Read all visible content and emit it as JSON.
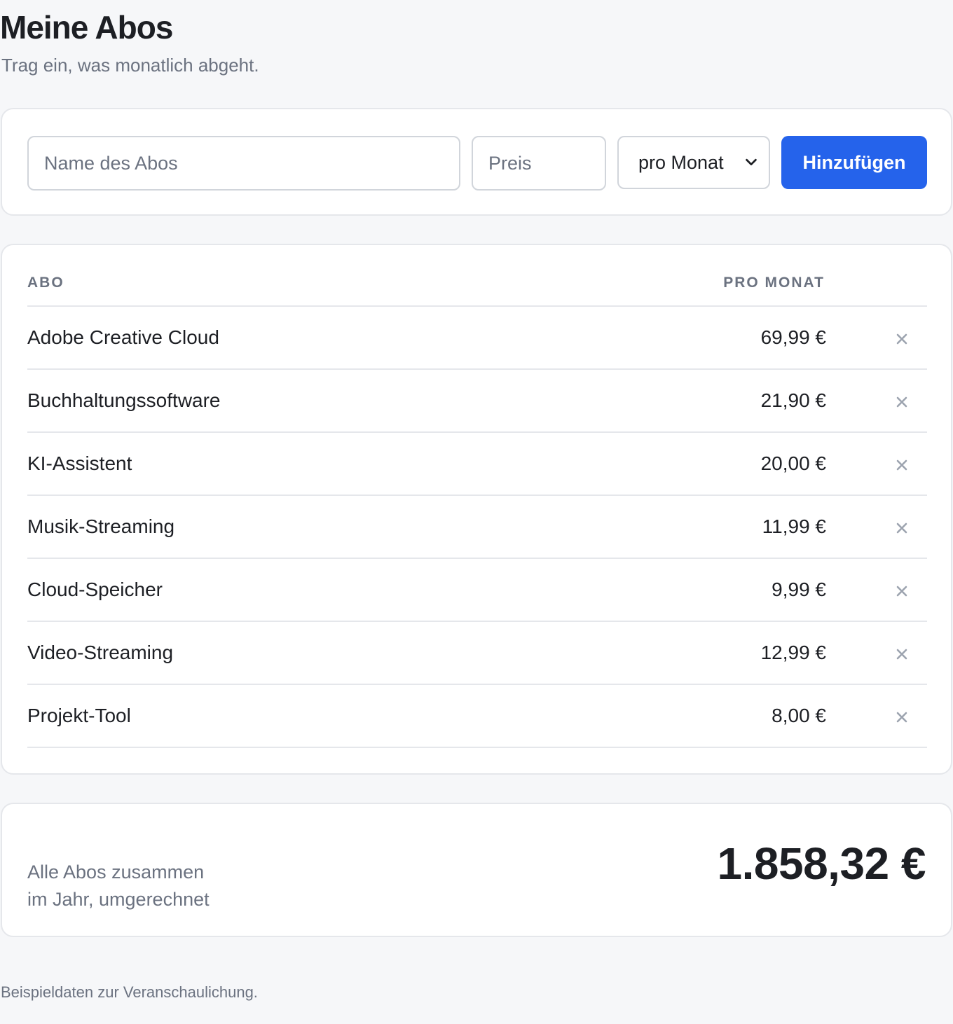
{
  "header": {
    "title": "Meine Abos",
    "subtitle": "Trag ein, was monatlich abgeht."
  },
  "add_form": {
    "name_placeholder": "Name des Abos",
    "price_placeholder": "Preis",
    "interval_selected": "pro Monat",
    "add_label": "Hinzufügen",
    "accent_color": "#2563eb"
  },
  "table": {
    "columns": [
      "ABO",
      "PRO MONAT"
    ],
    "rows": [
      {
        "name": "Adobe Creative Cloud",
        "price": "69,99 €"
      },
      {
        "name": "Buchhaltungssoftware",
        "price": "21,90 €"
      },
      {
        "name": "KI-Assistent",
        "price": "20,00 €"
      },
      {
        "name": "Musik-Streaming",
        "price": "11,99 €"
      },
      {
        "name": "Cloud-Speicher",
        "price": "9,99 €"
      },
      {
        "name": "Video-Streaming",
        "price": "12,99 €"
      },
      {
        "name": "Projekt-Tool",
        "price": "8,00 €"
      }
    ],
    "remove_icon": "close-icon"
  },
  "total": {
    "label_line1": "Alle Abos zusammen",
    "label_line2": "im Jahr, umgerechnet",
    "value": "1.858,32 €"
  },
  "footer": {
    "note": "Beispieldaten zur Veranschaulichung."
  }
}
